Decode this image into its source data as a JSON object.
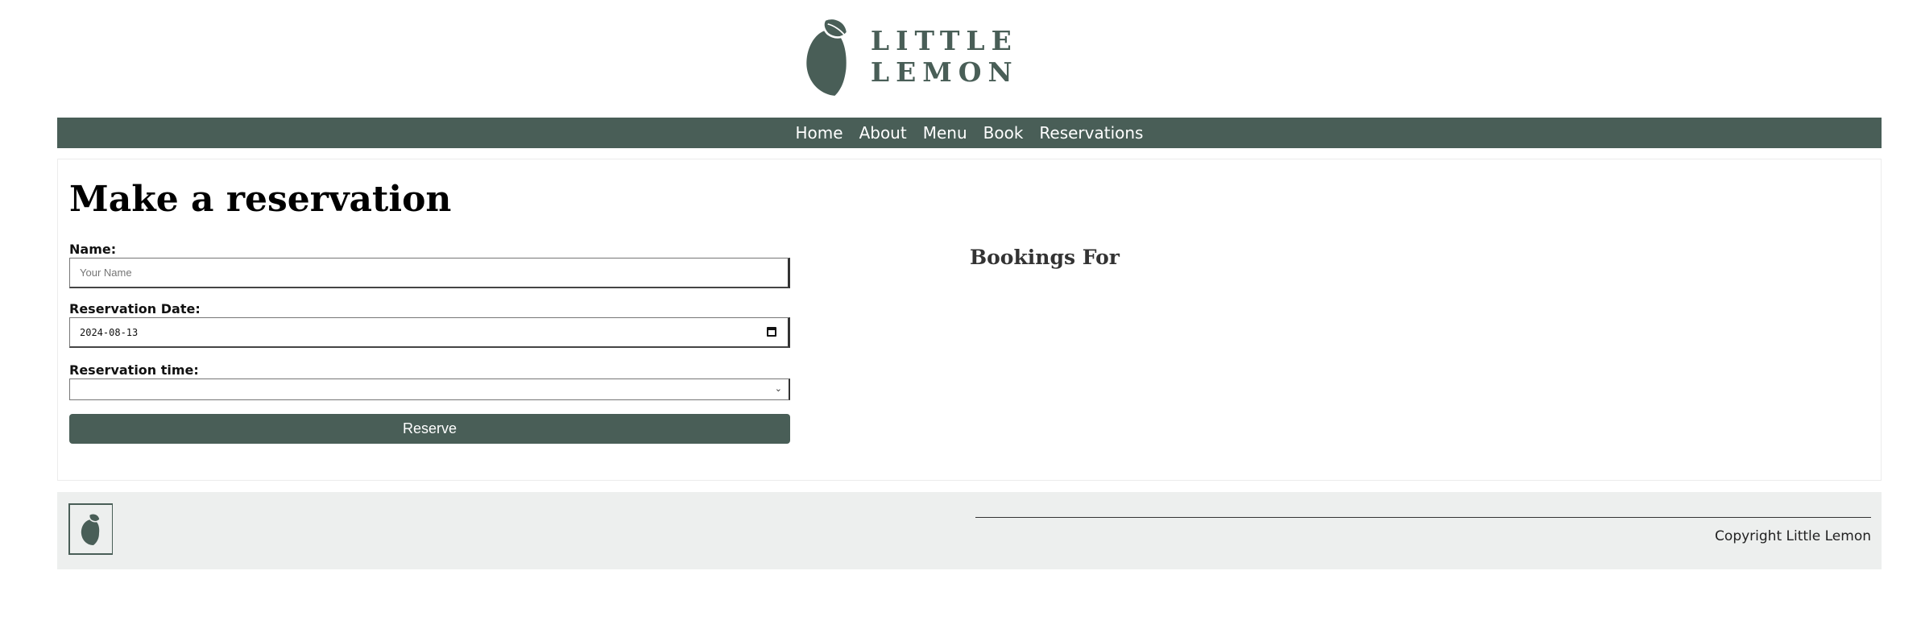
{
  "header": {
    "brand_name": "LITTLE LEMON",
    "logo_icon": "lemon-logo-icon"
  },
  "nav": {
    "items": [
      {
        "label": "Home"
      },
      {
        "label": "About"
      },
      {
        "label": "Menu"
      },
      {
        "label": "Book"
      },
      {
        "label": "Reservations"
      }
    ]
  },
  "main": {
    "title": "Make a reservation",
    "form": {
      "name_label": "Name:",
      "name_placeholder": "Your Name",
      "date_label": "Reservation Date:",
      "date_value": "2024-08-13",
      "time_label": "Reservation time:",
      "time_value": "",
      "submit_label": "Reserve"
    },
    "bookings_heading": "Bookings For"
  },
  "footer": {
    "copyright": "Copyright Little Lemon"
  },
  "colors": {
    "brand_green": "#495e57",
    "footer_bg": "#edefee"
  }
}
